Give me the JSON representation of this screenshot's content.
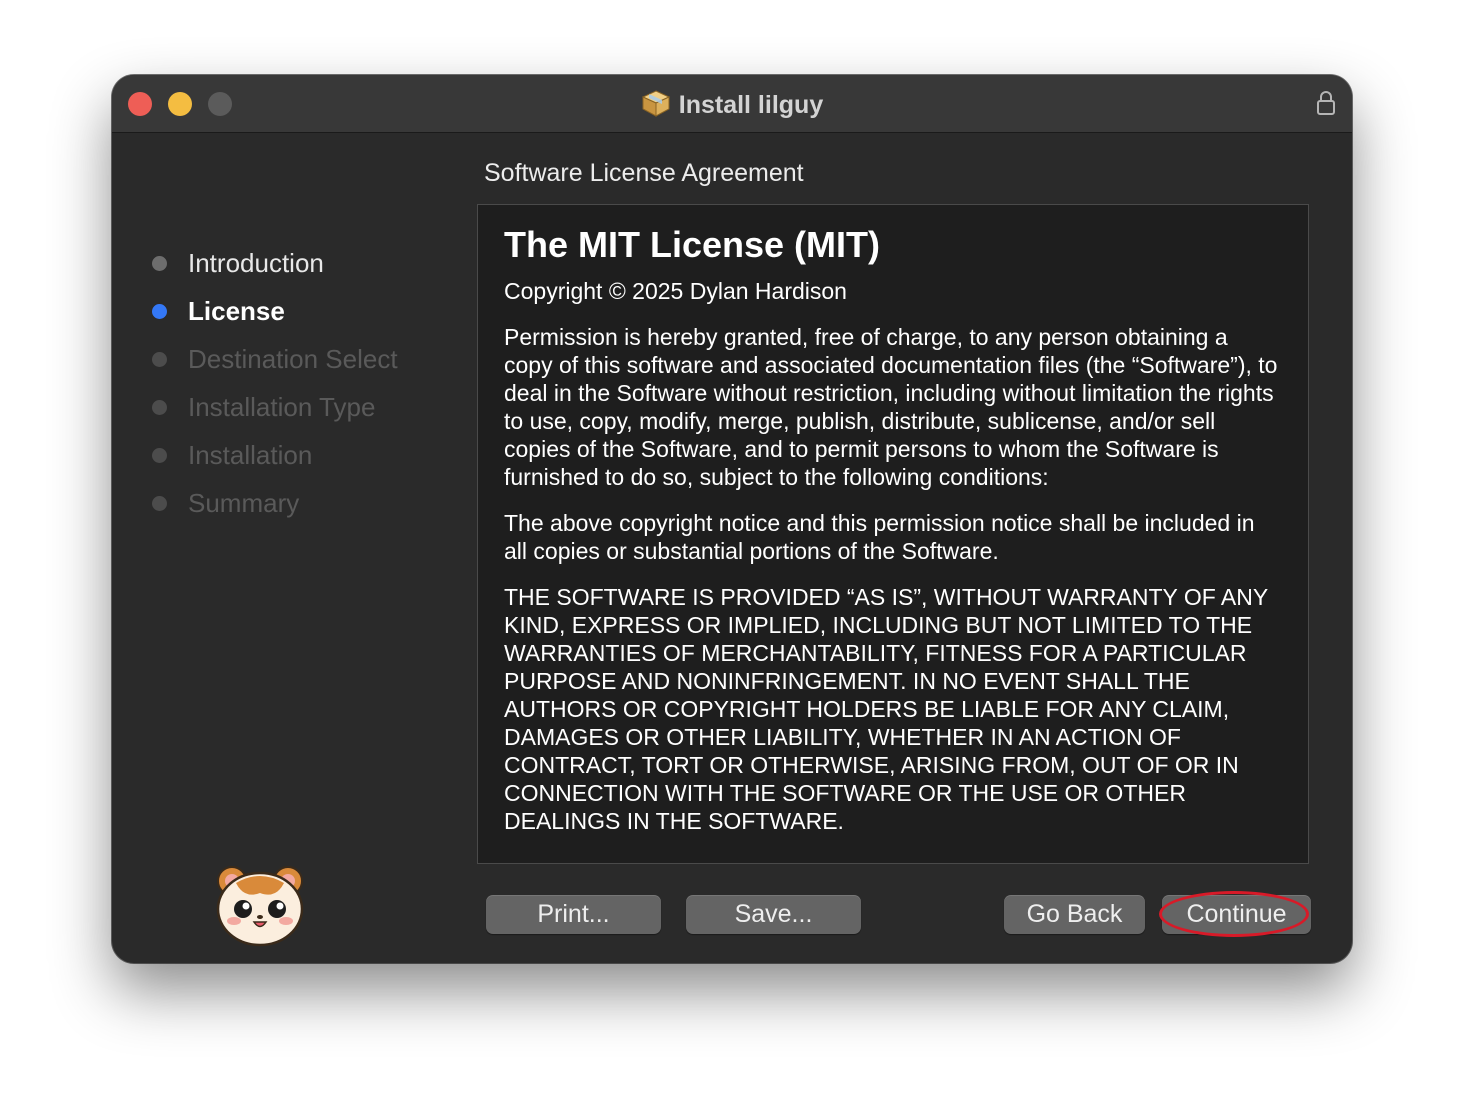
{
  "window": {
    "title": "Install lilguy",
    "title_icon": "package-icon",
    "lock_icon": "lock-icon"
  },
  "sidebar": {
    "steps": [
      {
        "label": "Introduction",
        "state": "done"
      },
      {
        "label": "License",
        "state": "current"
      },
      {
        "label": "Destination Select",
        "state": "pending"
      },
      {
        "label": "Installation Type",
        "state": "pending"
      },
      {
        "label": "Installation",
        "state": "pending"
      },
      {
        "label": "Summary",
        "state": "pending"
      }
    ],
    "mascot_icon": "hamster-mascot-icon"
  },
  "main": {
    "section_title": "Software License Agreement",
    "license": {
      "heading": "The MIT License (MIT)",
      "copyright": "Copyright © 2025 Dylan Hardison",
      "paragraphs": [
        "Permission is hereby granted, free of charge, to any person obtaining a copy of this software and associated documentation files (the “Software”), to deal in the Software without restriction, including without limitation the rights to use, copy, modify, merge, publish, distribute, sublicense, and/or sell copies of the Software, and to permit persons to whom the Software is furnished to do so, subject to the following conditions:",
        "The above copyright notice and this permission notice shall be included in all copies or substantial portions of the Software.",
        "THE SOFTWARE IS PROVIDED “AS IS”, WITHOUT WARRANTY OF ANY KIND, EXPRESS OR IMPLIED, INCLUDING BUT NOT LIMITED TO THE WARRANTIES OF MERCHANTABILITY, FITNESS FOR A PARTICULAR PURPOSE AND NONINFRINGEMENT. IN NO EVENT SHALL THE AUTHORS OR COPYRIGHT HOLDERS BE LIABLE FOR ANY CLAIM, DAMAGES OR OTHER LIABILITY, WHETHER IN AN ACTION OF CONTRACT, TORT OR OTHERWISE, ARISING FROM, OUT OF OR IN CONNECTION WITH THE SOFTWARE OR THE USE OR OTHER DEALINGS IN THE SOFTWARE."
      ]
    }
  },
  "buttons": {
    "print": "Print...",
    "save": "Save...",
    "go_back": "Go Back",
    "continue": "Continue"
  },
  "colors": {
    "close": "#ee5e56",
    "minimize": "#f4bd41",
    "current_step": "#3478f6",
    "highlight": "#d81a28"
  }
}
